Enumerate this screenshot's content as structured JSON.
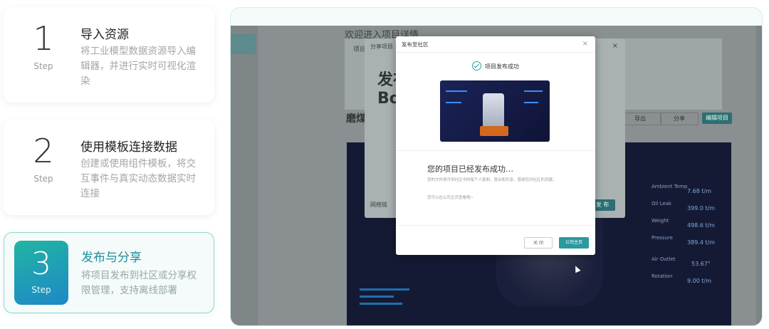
{
  "steps": [
    {
      "number": "1",
      "step_label": "Step",
      "title": "导入资源",
      "desc": "将工业模型数据资源导入编辑器，并进行实时可视化渲染"
    },
    {
      "number": "2",
      "step_label": "Step",
      "title": "使用模板连接数据",
      "desc": "创建或使用组件模板，将交互事件与真实动态数据实时连接"
    },
    {
      "number": "3",
      "step_label": "Step",
      "title": "发布与分享",
      "desc": "将项目发布到社区或分享权限管理，支持离线部署"
    }
  ],
  "screenshot": {
    "background_page": {
      "header": "欢迎进入项目详情",
      "subheader": "项目",
      "title": "磨煤",
      "buttons": [
        "导出",
        "分享",
        "编辑项目"
      ]
    },
    "back_modal": {
      "tab": "分享项目",
      "close": "×",
      "title_line1": "发布",
      "title_line2": "Bo",
      "footer_text": "网络链",
      "publish_button": "发 布"
    },
    "dialog": {
      "title": "发布至社区",
      "close": "×",
      "success_text": "项目发布成功",
      "message": "您的项目已经发布成功…",
      "sub_message": "您的文件将可供社区中的每个人复制、混合和共享。感谢您对社区的贡献。",
      "sub_message2": "您可以在公司主页查看哦~",
      "close_button": "关 闭",
      "home_button": "公司主页"
    },
    "dashboard": {
      "stats": [
        {
          "label": "Ambient Temp",
          "value": "7.68 t/m"
        },
        {
          "label": "Oil Leak",
          "value": "399.0 t/m"
        },
        {
          "label": "Weight",
          "value": "498.6 t/m"
        },
        {
          "label": "Pressure",
          "value": "389.4 t/m"
        },
        {
          "label": "Air Outlet",
          "value": "53.67°"
        },
        {
          "label": "Rotation",
          "value": "9.00 t/m"
        }
      ]
    }
  },
  "colors": {
    "accent": "#1c8f9b",
    "step3_gradient_start": "#22b5a2",
    "step3_gradient_end": "#1d88c8"
  }
}
